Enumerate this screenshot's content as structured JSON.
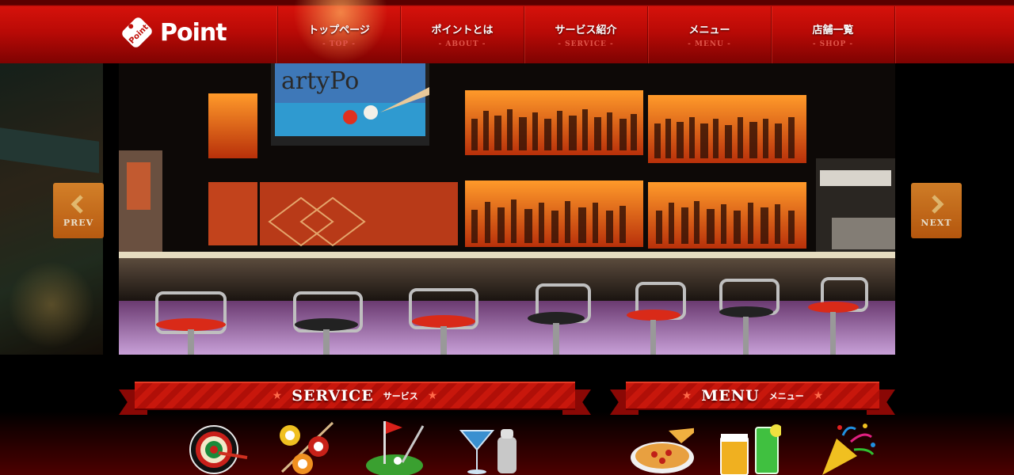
{
  "brand": {
    "name": "Point",
    "mark_text": "Point"
  },
  "nav": [
    {
      "jp": "トップページ",
      "en": "- TOP -"
    },
    {
      "jp": "ポイントとは",
      "en": "- ABOUT -"
    },
    {
      "jp": "サービス紹介",
      "en": "- SERVICE -"
    },
    {
      "jp": "メニュー",
      "en": "- MENU -"
    },
    {
      "jp": "店舗一覧",
      "en": "- SHOP -"
    }
  ],
  "hero": {
    "tv_text": "artyPo",
    "prev_label": "PREV",
    "next_label": "NEXT"
  },
  "sections": {
    "service": {
      "en": "SERVICE",
      "jp": "サービス"
    },
    "menu": {
      "en": "MENU",
      "jp": "メニュー"
    }
  },
  "icons": {
    "service": [
      "darts-icon",
      "billiards-icon",
      "golf-icon",
      "cocktail-icon"
    ],
    "menu": [
      "pizza-icon",
      "drinks-icon",
      "party-popper-icon"
    ]
  },
  "colors": {
    "header": "#b90a06",
    "accent": "#d6120b",
    "arrow": "#e0801f"
  }
}
